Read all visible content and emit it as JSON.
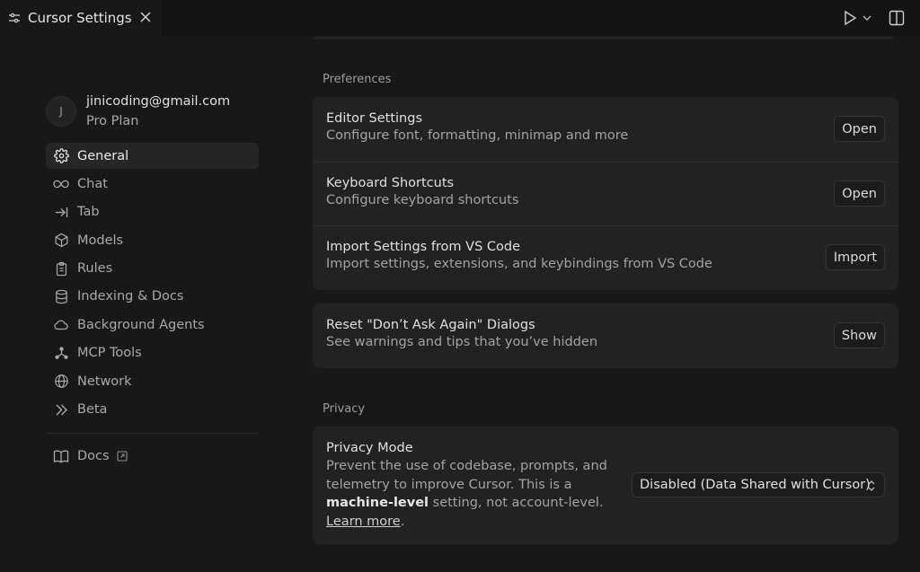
{
  "tab": {
    "title": "Cursor Settings",
    "icon": "sliders-icon",
    "close_icon": "close-icon"
  },
  "actions": {
    "run_icon": "play-icon",
    "layout_icon": "split-layout-icon"
  },
  "account": {
    "avatar_initial": "J",
    "email": "jinicoding@gmail.com",
    "plan": "Pro Plan"
  },
  "nav": {
    "items": [
      {
        "label": "General",
        "icon": "gear-icon",
        "active": true
      },
      {
        "label": "Chat",
        "icon": "infinity-icon"
      },
      {
        "label": "Tab",
        "icon": "tab-arrow-icon"
      },
      {
        "label": "Models",
        "icon": "cube-icon"
      },
      {
        "label": "Rules",
        "icon": "clipboard-icon"
      },
      {
        "label": "Indexing & Docs",
        "icon": "database-icon"
      },
      {
        "label": "Background Agents",
        "icon": "cloud-icon"
      },
      {
        "label": "MCP Tools",
        "icon": "nodes-icon"
      },
      {
        "label": "Network",
        "icon": "globe-icon"
      },
      {
        "label": "Beta",
        "icon": "double-chevron-icon"
      }
    ],
    "docs": {
      "label": "Docs",
      "icon": "book-icon"
    }
  },
  "preferences": {
    "label": "Preferences",
    "editor": {
      "title": "Editor Settings",
      "desc": "Configure font, formatting, minimap and more",
      "button": "Open"
    },
    "keyboard": {
      "title": "Keyboard Shortcuts",
      "desc": "Configure keyboard shortcuts",
      "button": "Open"
    },
    "import": {
      "title": "Import Settings from VS Code",
      "desc": "Import settings, extensions, and keybindings from VS Code",
      "button": "Import"
    },
    "reset": {
      "title": "Reset \"Don’t Ask Again\" Dialogs",
      "desc": "See warnings and tips that you’ve hidden",
      "button": "Show"
    }
  },
  "privacy": {
    "label": "Privacy",
    "title": "Privacy Mode",
    "desc_1": "Prevent the use of codebase, prompts, and telemetry to improve Cursor. This is a ",
    "desc_bold": "machine-level",
    "desc_2": " setting, not account-level. ",
    "learn_more": "Learn more",
    "desc_end": ".",
    "select_value": "Disabled (Data Shared with Cursor)"
  }
}
